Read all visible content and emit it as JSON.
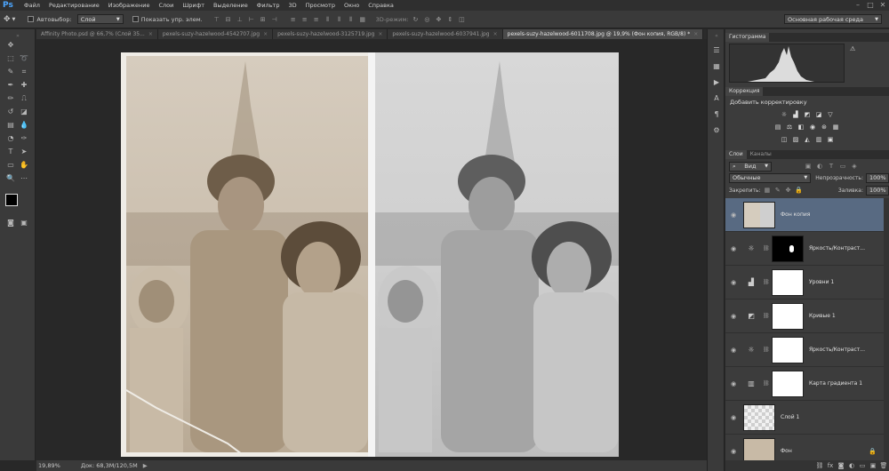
{
  "app": {
    "logo": "Ps"
  },
  "menu": [
    "Файл",
    "Редактирование",
    "Изображение",
    "Слои",
    "Шрифт",
    "Выделение",
    "Фильтр",
    "3D",
    "Просмотр",
    "Окно",
    "Справка"
  ],
  "window_controls": [
    "–",
    "□",
    "✕"
  ],
  "options": {
    "autoselect_label": "Автовыбор:",
    "autoselect_value": "Слой",
    "show_controls_label": "Показать упр. элем.",
    "mode_3d_label": "3D-режим:",
    "workspace": "Основная рабочая среда"
  },
  "tabs": [
    {
      "label": "Affinity Photo.psd @ 66,7% (Слой 35...",
      "active": false
    },
    {
      "label": "pexels-suzy-hazelwood-4542707.jpg",
      "active": false
    },
    {
      "label": "pexels-suzy-hazelwood-3125719.jpg",
      "active": false
    },
    {
      "label": "pexels-suzy-hazelwood-6037941.jpg",
      "active": false
    },
    {
      "label": "pexels-suzy-hazelwood-6011708.jpg @ 19,9% (Фон копия, RGB/8) *",
      "active": true
    }
  ],
  "tab_close": "×",
  "status": {
    "zoom": "19,89%",
    "doc": "Док: 68,3M/120,5M"
  },
  "panels": {
    "histogram_title": "Гистограмма",
    "correction_title": "Коррекция",
    "add_correction": "Добавить корректировку",
    "layers_tab": "Слои",
    "channels_tab": "Каналы",
    "filter_kind": "Вид",
    "blend_mode": "Обычные",
    "opacity_label": "Непрозрачность:",
    "opacity_value": "100%",
    "lock_label": "Закрепить:",
    "fill_label": "Заливка:",
    "fill_value": "100%"
  },
  "layers": [
    {
      "name": "Фон копия",
      "selected": true
    },
    {
      "name": "Яркость/Контраст...",
      "selected": false
    },
    {
      "name": "Уровни 1",
      "selected": false
    },
    {
      "name": "Кривые 1",
      "selected": false
    },
    {
      "name": "Яркость/Контраст...",
      "selected": false
    },
    {
      "name": "Карта градиента 1",
      "selected": false
    },
    {
      "name": "Слой 1",
      "selected": false
    },
    {
      "name": "Фон",
      "selected": false
    }
  ]
}
